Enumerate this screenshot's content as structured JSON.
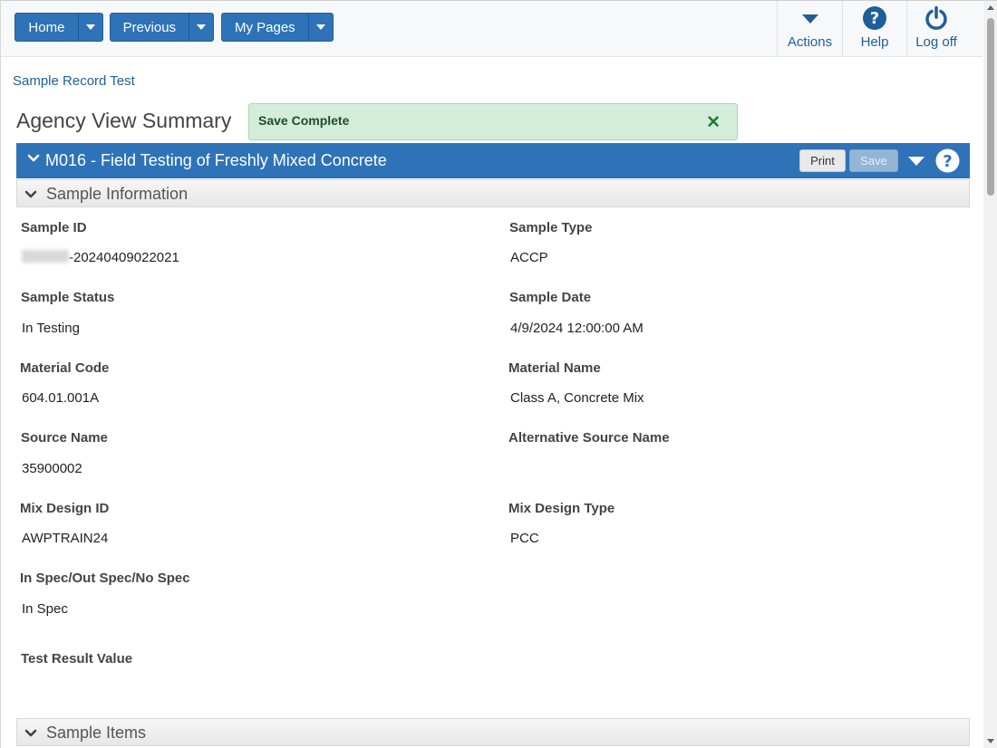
{
  "nav": {
    "home": "Home",
    "previous": "Previous",
    "my_pages": "My Pages"
  },
  "top_actions": {
    "actions": "Actions",
    "help": "Help",
    "logoff": "Log off"
  },
  "breadcrumb": "Sample Record Test",
  "page_title": "Agency View Summary",
  "alert": {
    "message": "Save Complete",
    "close": "✕"
  },
  "section": {
    "title": "M016 - Field Testing of Freshly Mixed Concrete",
    "print_label": "Print",
    "save_label": "Save"
  },
  "sample_information": {
    "title": "Sample Information",
    "fields": {
      "sample_id": {
        "label": "Sample ID",
        "value": "-20240409022021"
      },
      "sample_type": {
        "label": "Sample Type",
        "value": "ACCP"
      },
      "sample_status": {
        "label": "Sample Status",
        "value": "In Testing"
      },
      "sample_date": {
        "label": "Sample Date",
        "value": "4/9/2024 12:00:00 AM"
      },
      "material_code": {
        "label": "Material Code",
        "value": "604.01.001A"
      },
      "material_name": {
        "label": "Material Name",
        "value": "Class A, Concrete Mix"
      },
      "source_name": {
        "label": "Source Name",
        "value": "35900002"
      },
      "alt_source_name": {
        "label": "Alternative Source Name",
        "value": ""
      },
      "mix_design_id": {
        "label": "Mix Design ID",
        "value": "AWPTRAIN24"
      },
      "mix_design_type": {
        "label": "Mix Design Type",
        "value": "PCC"
      },
      "spec": {
        "label": "In Spec/Out Spec/No Spec",
        "value": "In Spec"
      },
      "test_result_value": {
        "label": "Test Result Value",
        "value": ""
      }
    }
  },
  "sample_items": {
    "title": "Sample Items"
  },
  "colors": {
    "primary": "#2e73b8",
    "alert_bg": "#d4edda",
    "alert_text": "#1e4d2b"
  }
}
